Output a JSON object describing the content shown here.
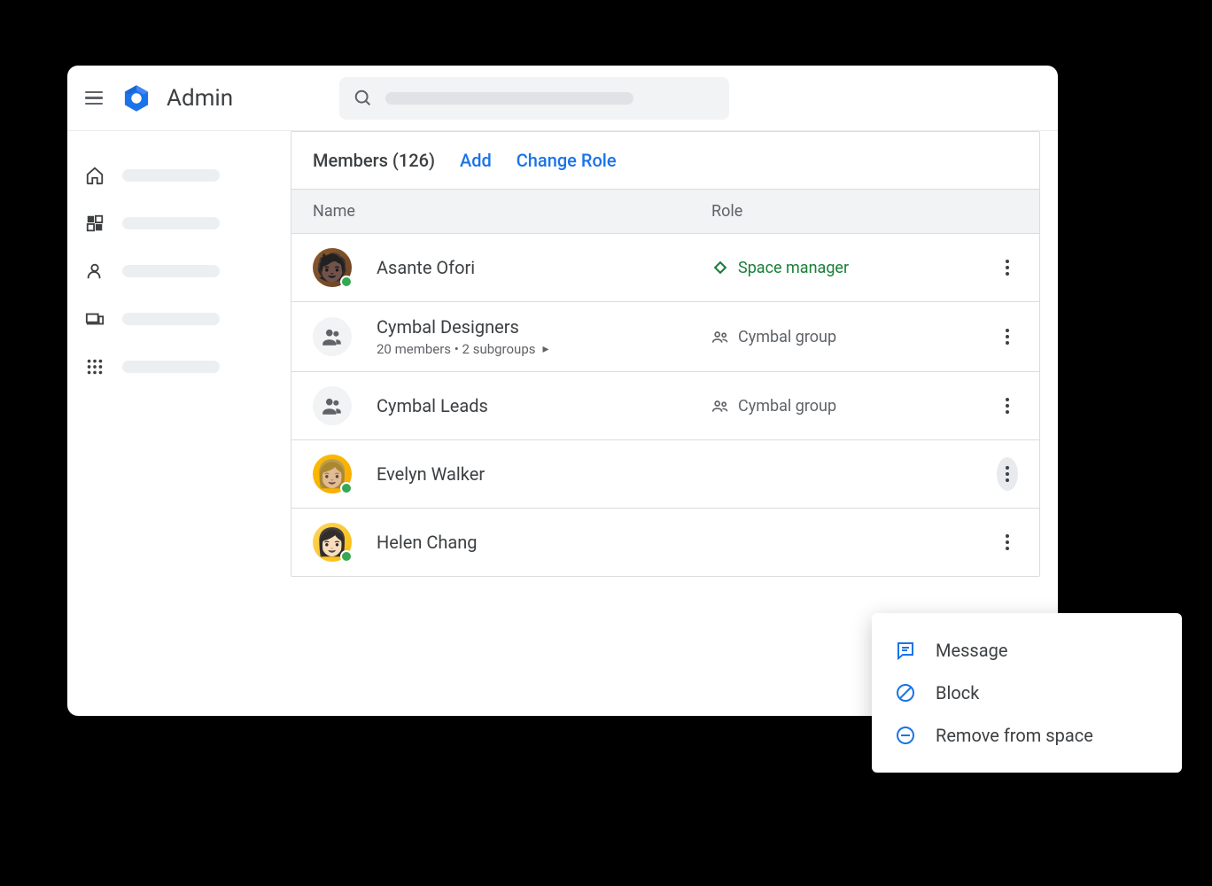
{
  "header": {
    "app_title": "Admin"
  },
  "panel": {
    "title": "Members (126)",
    "add_label": "Add",
    "change_role_label": "Change Role",
    "col_name": "Name",
    "col_role": "Role"
  },
  "members": [
    {
      "name": "Asante Ofori",
      "role": "Space manager",
      "role_type": "manager",
      "sub": null,
      "avatar_type": "person",
      "presence": true
    },
    {
      "name": "Cymbal Designers",
      "role": "Cymbal group",
      "role_type": "group",
      "sub": "20 members  •  2 subgroups",
      "avatar_type": "group",
      "presence": false
    },
    {
      "name": "Cymbal Leads",
      "role": "Cymbal group",
      "role_type": "group",
      "sub": null,
      "avatar_type": "group",
      "presence": false
    },
    {
      "name": "Evelyn Walker",
      "role": "",
      "role_type": "",
      "sub": null,
      "avatar_type": "person",
      "presence": true
    },
    {
      "name": "Helen Chang",
      "role": "",
      "role_type": "",
      "sub": null,
      "avatar_type": "person",
      "presence": true
    }
  ],
  "popover": {
    "message_label": "Message",
    "block_label": "Block",
    "remove_label": "Remove from space"
  }
}
